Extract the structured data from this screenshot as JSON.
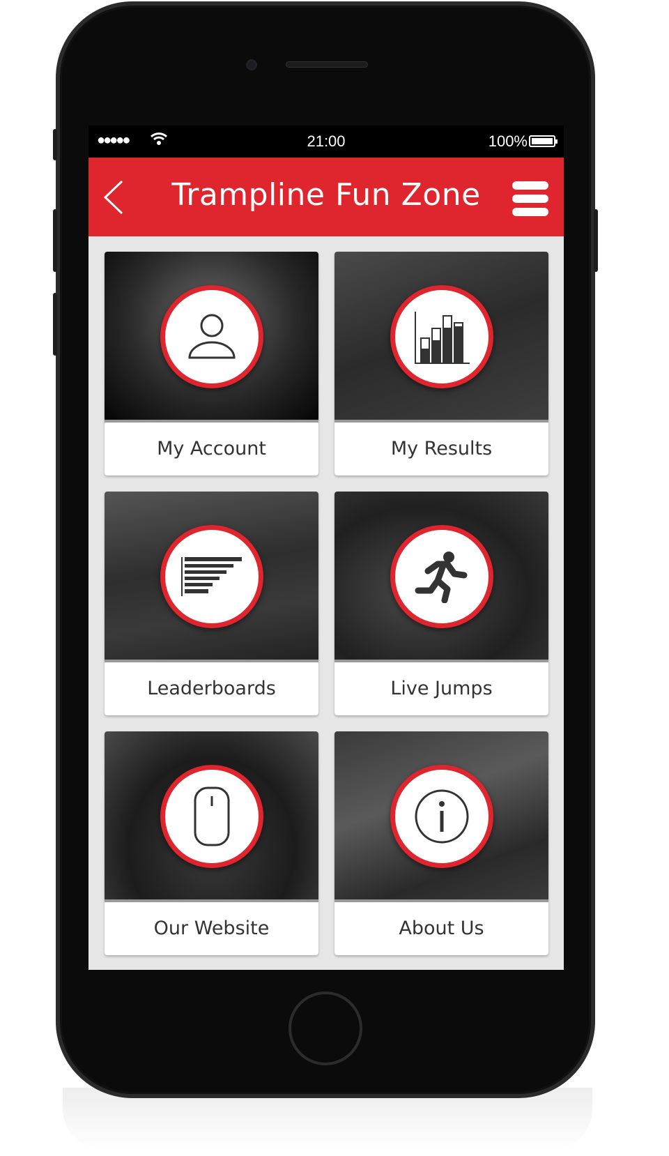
{
  "status_bar": {
    "signal": "●●●●●",
    "time": "21:00",
    "battery": "100%",
    "battery_level": 100
  },
  "header": {
    "title": "Trampline Fun Zone",
    "back_icon": "chevron-left-icon",
    "menu_icon": "hamburger-menu-icon"
  },
  "tiles": [
    {
      "label": "My Account",
      "icon": "user-icon"
    },
    {
      "label": "My Results",
      "icon": "bar-chart-icon"
    },
    {
      "label": "Leaderboards",
      "icon": "leaderboard-icon"
    },
    {
      "label": "Live Jumps",
      "icon": "running-person-icon"
    },
    {
      "label": "Our Website",
      "icon": "mouse-icon"
    },
    {
      "label": "About Us",
      "icon": "info-icon"
    }
  ],
  "colors": {
    "brand": "#df252e",
    "background": "#e6e6e6"
  }
}
